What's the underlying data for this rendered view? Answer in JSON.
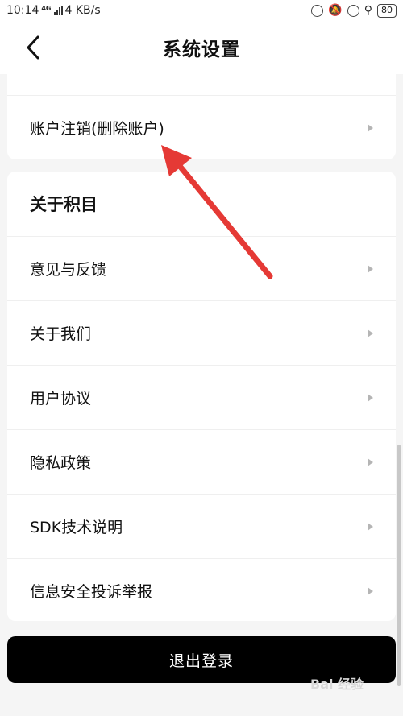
{
  "status_bar": {
    "time": "10:14",
    "network": "4G",
    "speed": "4 KB/s",
    "battery": "80"
  },
  "nav": {
    "title": "系统设置"
  },
  "account_section": {
    "items": [
      {
        "label": "账户注销(删除账户)"
      }
    ]
  },
  "about_section": {
    "title": "关于积目",
    "items": [
      {
        "label": "意见与反馈"
      },
      {
        "label": "关于我们"
      },
      {
        "label": "用户协议"
      },
      {
        "label": "隐私政策"
      },
      {
        "label": "SDK技术说明"
      },
      {
        "label": "信息安全投诉举报"
      }
    ]
  },
  "logout": {
    "label": "退出登录"
  },
  "watermark": {
    "text": "Bai 经验"
  },
  "colors": {
    "annotation_arrow": "#e53935",
    "button_bg": "#000000"
  }
}
